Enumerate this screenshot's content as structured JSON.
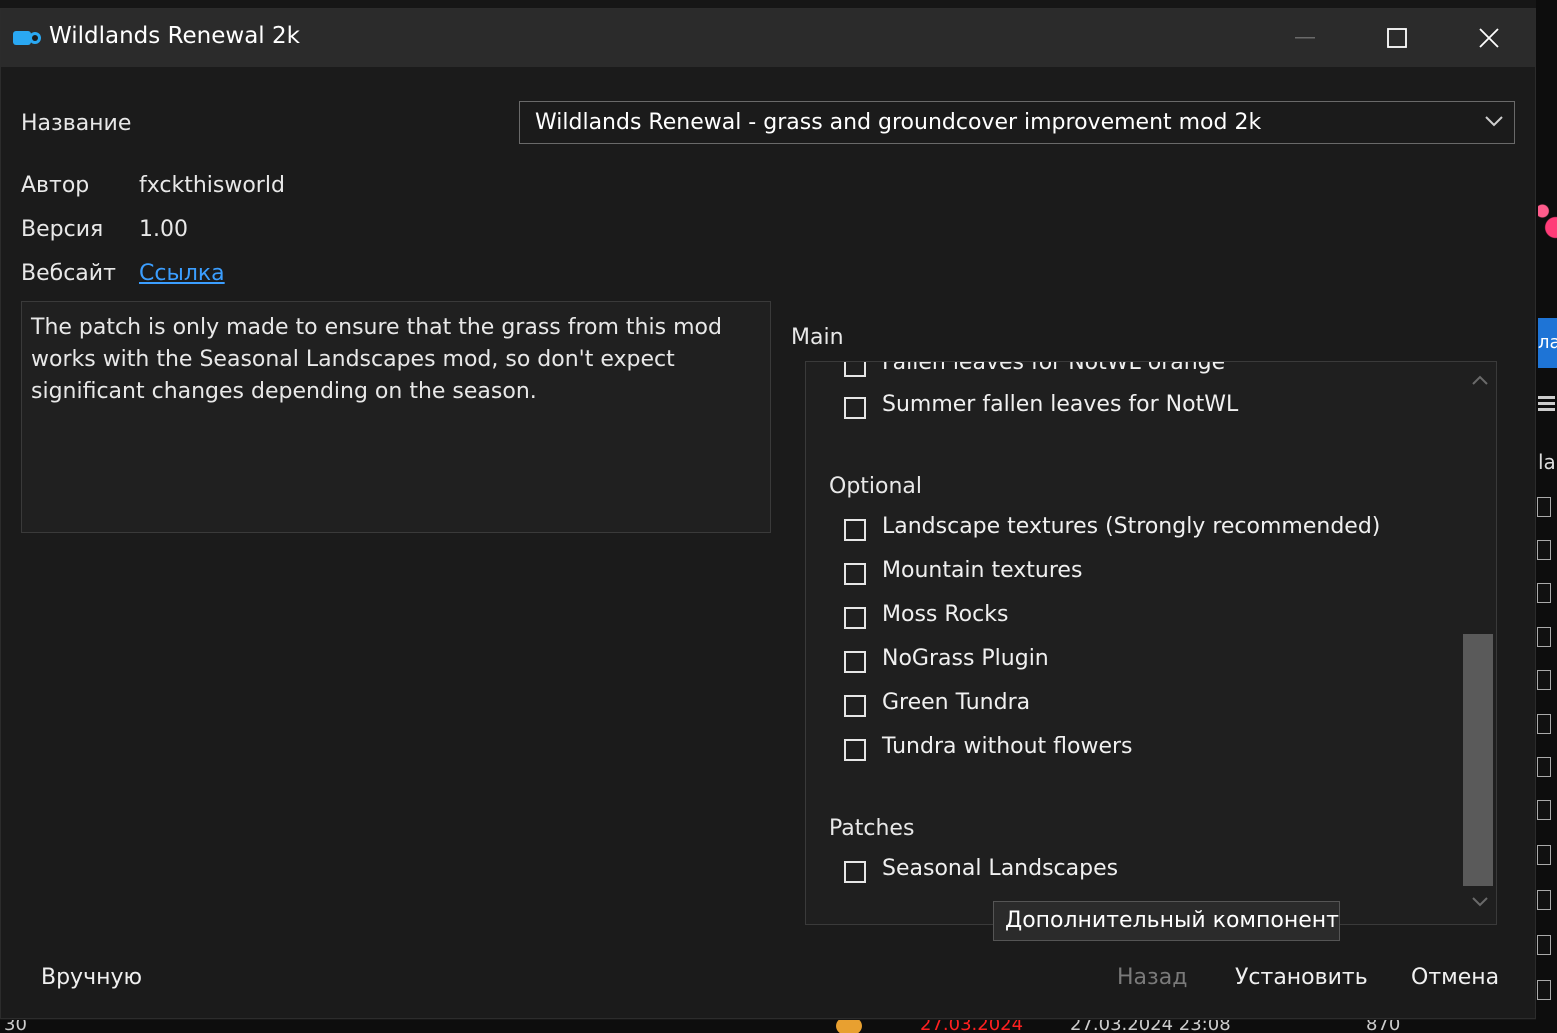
{
  "window": {
    "title": "Wildlands Renewal 2k"
  },
  "fields": {
    "name_label": "Название",
    "name_value": "Wildlands Renewal - grass and groundcover improvement mod 2k",
    "author_label": "Автор",
    "author_value": "fxckthisworld",
    "version_label": "Версия",
    "version_value": "1.00",
    "website_label": "Вебсайт",
    "website_link": "Ссылка"
  },
  "description": "The patch is only made to ensure that the grass from this mod works with the Seasonal Landscapes mod, so don't expect significant changes depending on the season.",
  "options": {
    "main_label": "Main",
    "main_items": [
      "Fallen leaves for NotWL orange",
      "Summer fallen leaves for NotWL"
    ],
    "optional_label": "Optional",
    "optional_items": [
      "Landscape textures (Strongly recommended)",
      "Mountain textures",
      "Moss Rocks",
      "NoGrass Plugin",
      "Green Tundra",
      "Tundra without flowers"
    ],
    "patches_label": "Patches",
    "patches_items": [
      "Seasonal Landscapes"
    ],
    "tooltip": "Дополнительный компонент"
  },
  "buttons": {
    "manual": "Вручную",
    "back": "Назад",
    "install": "Установить",
    "cancel": "Отмена"
  },
  "background": {
    "side_text_1": "ла",
    "side_text_2": "la",
    "bottom_1": "30",
    "bottom_2": "27.03.2024",
    "bottom_3": "27.03.2024 23:08",
    "bottom_4": "870"
  },
  "colors": {
    "accent_link": "#3b9eff",
    "titlebar": "#2b2b2b",
    "background": "#1b1b1b",
    "date_red": "#ff2020"
  }
}
